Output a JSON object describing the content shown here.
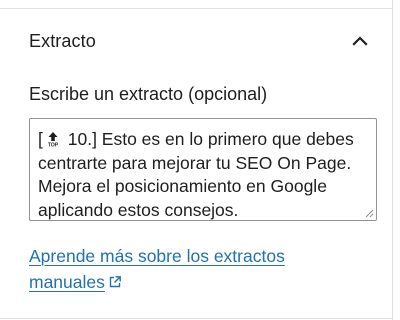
{
  "panel": {
    "title": "Extracto",
    "toggle_icon": "chevron-up-icon",
    "field_label": "Escribe un extracto (opcional)",
    "textarea": {
      "value_prefix": "[",
      "emoji": "top-arrow-emoji",
      "value_rest": " 10.] Esto es en lo primero que debes centrarte para mejorar tu SEO On Page. Mejora el posicionamiento en Google aplicando estos consejos."
    },
    "help_link": {
      "label": "Aprende más sobre los extractos manuales",
      "icon": "external-link-icon"
    }
  },
  "colors": {
    "link": "#2271b1",
    "text": "#1e1e1e",
    "border": "#949494",
    "divider": "#e0e0e0"
  }
}
